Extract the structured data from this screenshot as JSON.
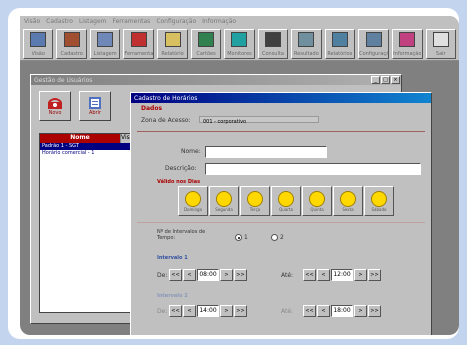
{
  "menu": [
    "Visão",
    "Cadastro",
    "Listagem",
    "Ferramentas",
    "Configuração",
    "Informação"
  ],
  "toolbar": [
    {
      "label": "Visão",
      "icon": "book-icon",
      "color": "#5a7ab0"
    },
    {
      "label": "Cadastro",
      "icon": "people-icon",
      "color": "#a05030"
    },
    {
      "label": "Listagem",
      "icon": "building-icon",
      "color": "#7088b8"
    },
    {
      "label": "Ferramentas",
      "icon": "gift-icon",
      "color": "#c03030"
    },
    {
      "label": "Relatório",
      "icon": "report-icon",
      "color": "#d8c060"
    },
    {
      "label": "Cartões",
      "icon": "cards-icon",
      "color": "#308050"
    },
    {
      "label": "Monitores",
      "icon": "monitor-icon",
      "color": "#20a0a0"
    },
    {
      "label": "Consulta",
      "icon": "search-icon",
      "color": "#404040"
    },
    {
      "label": "Resultado",
      "icon": "tools-icon",
      "color": "#7090a0"
    },
    {
      "label": "Relatórios",
      "icon": "list-icon",
      "color": "#5080a0"
    },
    {
      "label": "Configuração",
      "icon": "globe-icon",
      "color": "#6080a0"
    },
    {
      "label": "Informação",
      "icon": "cube-icon",
      "color": "#c04080"
    },
    {
      "label": "Sair",
      "icon": "exit-icon",
      "color": "#e0e0e0"
    }
  ],
  "window1": {
    "title": "Gestão de Usuários",
    "buttons": [
      {
        "label": "Novo"
      },
      {
        "label": "Abrir"
      }
    ],
    "list": {
      "col_name": "Nome",
      "col_vis": "Vis",
      "rows": [
        "Padrão 1 - SGT",
        "Horário comercial - 1"
      ]
    }
  },
  "window2": {
    "title": "Cadastro de Horários",
    "section_dados": "Dados",
    "zona_label": "Zona de Acesso:",
    "zona_value": "001 - corporativo",
    "nome_label": "Nome:",
    "nome_value": "",
    "descricao_label": "Descrição:",
    "descricao_value": "",
    "section_dias": "Válido nos Dias",
    "days": [
      "Domingo",
      "Segunda",
      "Terça",
      "Quarta",
      "Quinta",
      "Sexta",
      "Sábado"
    ],
    "intervals_label": "Nº de Intervalos de Tempo:",
    "radio1": "1",
    "radio2": "2",
    "interval1_label": "Intervalo 1",
    "interval2_label": "Intervalo 2",
    "de_label": "De:",
    "ate_label": "Até:",
    "interval1_from": "08:00",
    "interval1_to": "12:00",
    "interval2_from": "14:00",
    "interval2_to": "18:00"
  }
}
